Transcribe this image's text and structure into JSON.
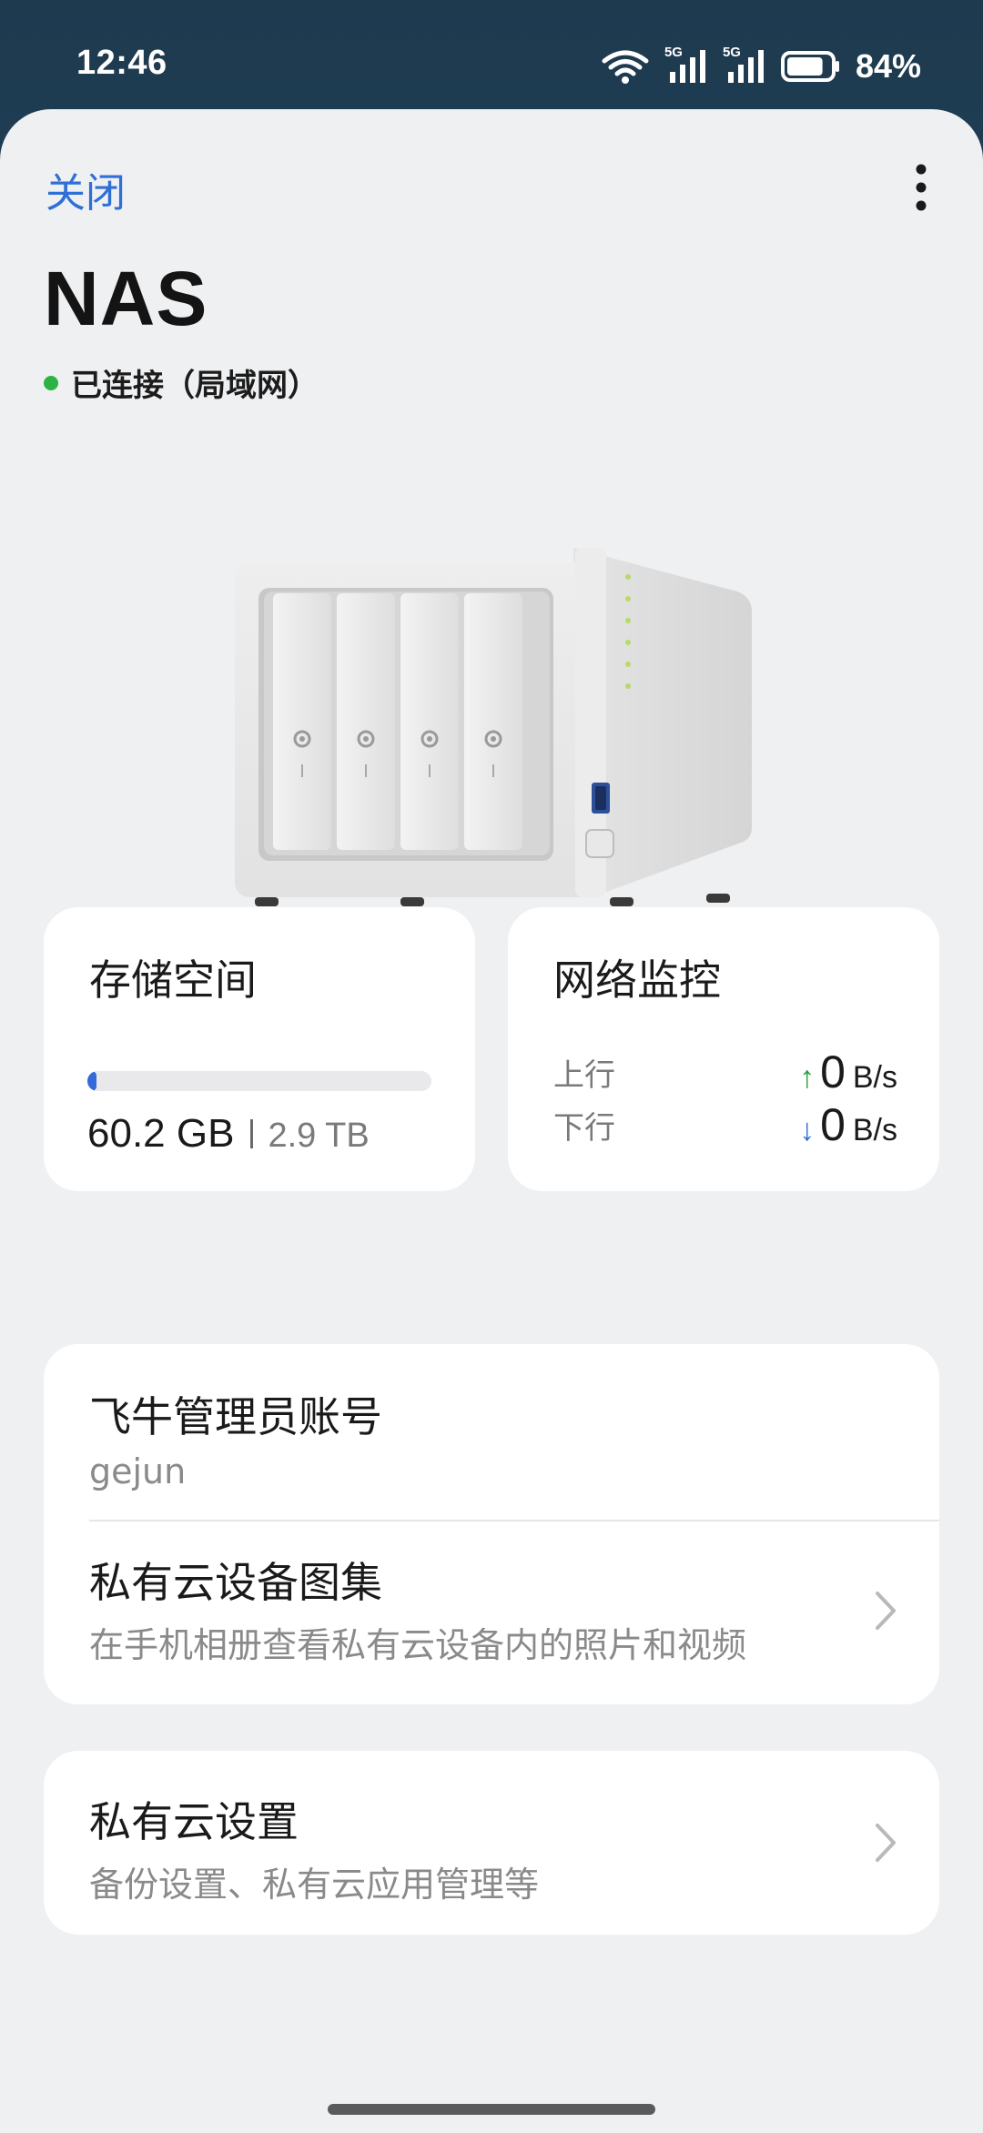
{
  "status_bar": {
    "time": "12:46",
    "network_labels": [
      "5G",
      "5G"
    ],
    "battery_percent": "84%",
    "battery_level": 0.84
  },
  "header": {
    "close_label": "关闭",
    "more_icon": "more-vertical-icon",
    "title": "NAS",
    "connection_status": "已连接（局域网）",
    "status_color": "#2db344"
  },
  "storage": {
    "heading": "存储空间",
    "used": "60.2 GB",
    "total": "2.9 TB",
    "usage_fraction": 0.02,
    "bar_color": "#3569d9"
  },
  "network": {
    "heading": "网络监控",
    "upload": {
      "label": "上行",
      "arrow": "↑",
      "value": "0",
      "unit": "B/s",
      "color": "#2e9e3f"
    },
    "download": {
      "label": "下行",
      "arrow": "↓",
      "value": "0",
      "unit": "B/s",
      "color": "#2f6fd6"
    }
  },
  "account": {
    "title": "飞牛管理员账号",
    "username": "gejun"
  },
  "gallery": {
    "title": "私有云设备图集",
    "subtitle": "在手机相册查看私有云设备内的照片和视频"
  },
  "settings": {
    "title": "私有云设置",
    "subtitle": "备份设置、私有云应用管理等"
  },
  "colors": {
    "accent": "#2f6fd6",
    "sheet_background": "#eff0f2",
    "card_background": "#ffffff"
  }
}
